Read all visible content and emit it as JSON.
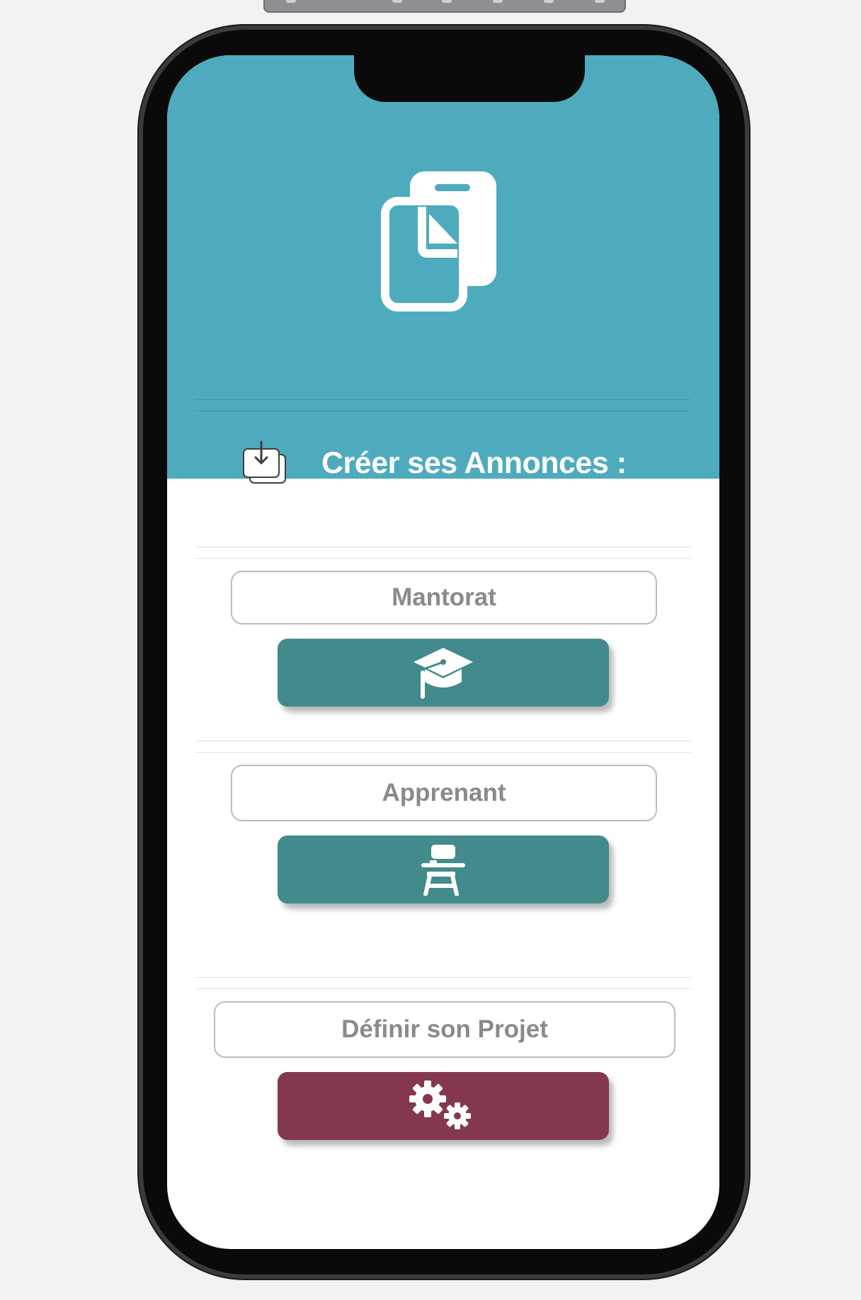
{
  "header": {
    "title": "Créer ses Annonces :",
    "hero_icon": "phone-documents-icon",
    "title_icon": "import-stack-icon",
    "background": "#4eabbe"
  },
  "sections": [
    {
      "label": "Mantorat",
      "button_icon": "graduation-cap-icon",
      "button_color": "#428a8b"
    },
    {
      "label": "Apprenant",
      "button_icon": "student-desk-icon",
      "button_color": "#428a8b"
    },
    {
      "label": "Définir son Projet",
      "button_icon": "gears-icon",
      "button_color": "#83384d"
    }
  ]
}
